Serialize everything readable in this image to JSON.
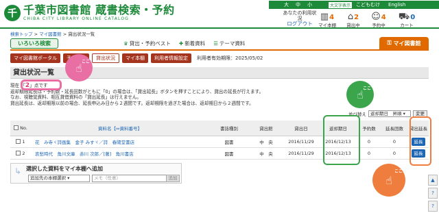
{
  "header": {
    "logo_mark": "千",
    "site_title": "千葉市図書館 蔵書検索・予約",
    "site_subtitle": "CHIBA CITY LIBRARY ONLINE CATALOG",
    "font_sizes": [
      "大",
      "中",
      "小"
    ],
    "big_chars": "大文字表示",
    "kids_link": "こどもむけ",
    "lang_link": "English",
    "user_label": "あなたの利用状況",
    "logout": "ログアウト",
    "icons": [
      {
        "label": "マイ本棚",
        "count": "4",
        "icon": "bookshelf-icon"
      },
      {
        "label": "貸出中",
        "count": "2",
        "icon": "house-icon"
      },
      {
        "label": "予約中",
        "count": "4",
        "icon": "person-icon"
      },
      {
        "label": "カート",
        "count": "0",
        "icon": "cart-icon"
      }
    ]
  },
  "breadcrumb": {
    "home": "検索トップ",
    "mypage": "マイ図書館",
    "current": "貸出状況一覧",
    "sep": ">"
  },
  "nav": {
    "iroiro": "いろいろ検索",
    "links": [
      {
        "label": "貸出・予約ベスト",
        "icon": "trophy-icon"
      },
      {
        "label": "新着資料",
        "icon": "plus-icon"
      },
      {
        "label": "テーマ資料",
        "icon": "list-icon"
      }
    ],
    "mytab": "マイ図書館"
  },
  "subbar": {
    "buttons": [
      "マイ図書館ポータル",
      "予約状況",
      "貸出状況",
      "マイ本棚",
      "利用者情報設定"
    ],
    "valid": "利用者有効期限：2025/05/02"
  },
  "section": {
    "title": "貸出状況一覧",
    "count_prefix": "現在",
    "count": "2",
    "count_suffix": "点です",
    "lines": [
      "返却期限延長は・予約数・延長回数がともに「0」の場合は、「貸出延長」ボタンを押すことにより、貸出の延長が行えます。",
      "なお、視聴覚資料、相互貸借資料の「貸出延長」は行えません。",
      "貸出延長は、返却期限以前の場合、延長申込み日から２週間です。返却期限を過ぎた場合は、返却期日から２週間です。"
    ]
  },
  "sort": {
    "label": "並び替え",
    "selected": "返却期日　昇順",
    "button": "変更"
  },
  "table": {
    "headers": [
      "No.",
      "資料名【⇔資料番号】",
      "書誌種別",
      "貸出館",
      "貸出日",
      "返却期日",
      "予約数",
      "延長回数",
      "貸出延長"
    ],
    "rows": [
      {
        "no": "1",
        "title": "花　み寺ヾ詩画集　金子 みすヾ／詩　春陽堂書店",
        "type": "図書",
        "library": "中　央",
        "loan": "2016/11/29",
        "due": "2016/12/13",
        "reserve": "0",
        "ext": "0",
        "btn": "延長"
      },
      {
        "no": "2",
        "title": "哀愁時代　角川文庫　赤川 次郎／[著]　角川書店",
        "type": "図書",
        "library": "中　央",
        "loan": "2016/11/29",
        "due": "2016/12/13",
        "reserve": "0",
        "ext": "0",
        "btn": "延長"
      }
    ]
  },
  "addpanel": {
    "title": "選択した資料をマイ本棚へ追加",
    "select": "追加先の本棚選択",
    "memo_placeholder": "メモ（任意）",
    "button": "追加"
  },
  "callouts": {
    "koko": "ここ"
  },
  "side": [
    "▲",
    "?",
    "?"
  ]
}
